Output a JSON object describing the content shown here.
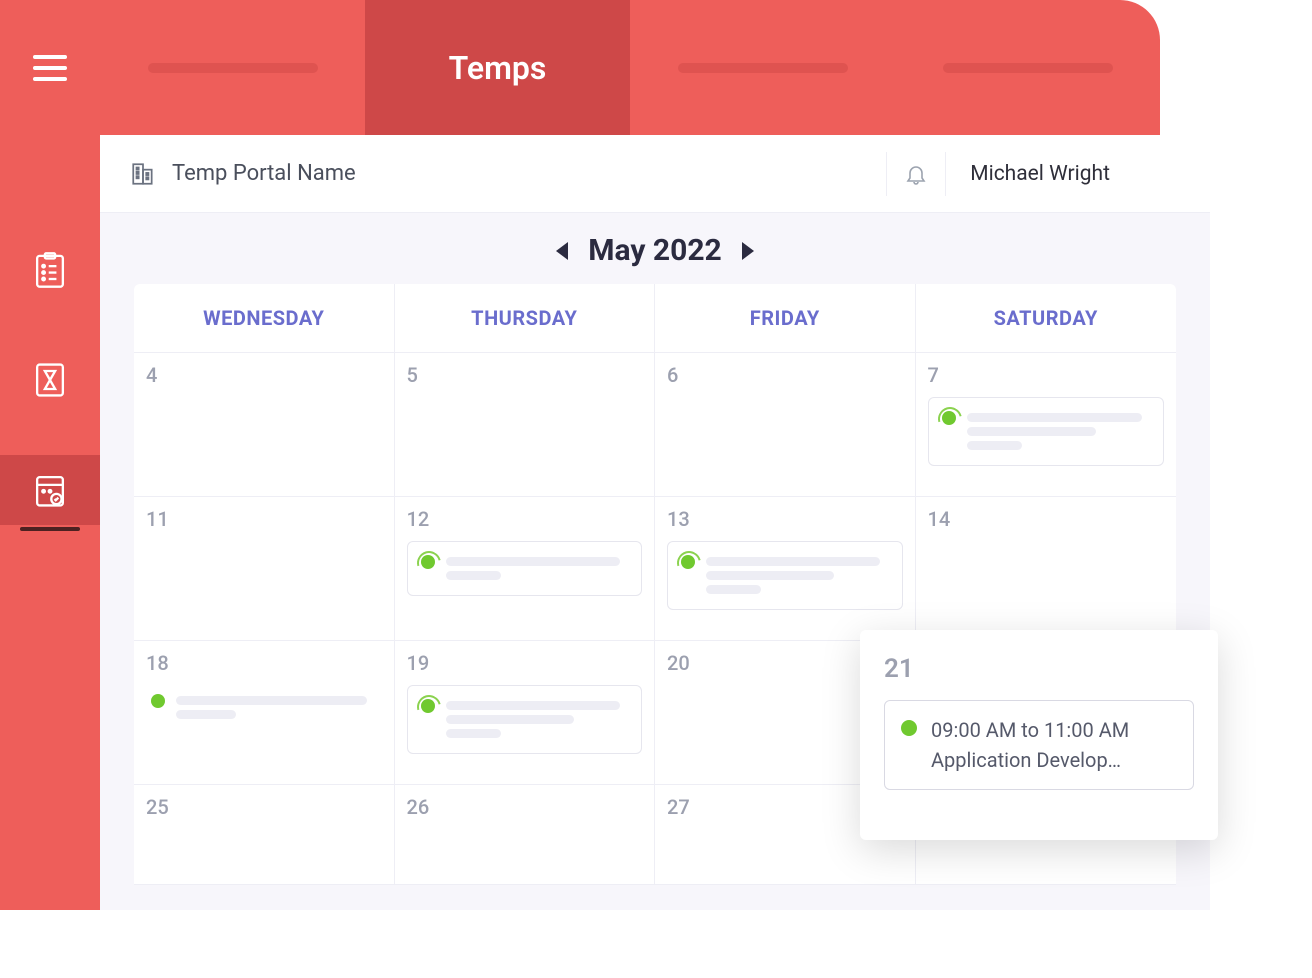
{
  "tabs": {
    "active_label": "Temps"
  },
  "header": {
    "portal_name": "Temp Portal Name",
    "user_name": "Michael Wright"
  },
  "month": {
    "label": "May 2022"
  },
  "weekdays": [
    "WEDNESDAY",
    "THURSDAY",
    "FRIDAY",
    "SATURDAY"
  ],
  "days": {
    "row1": [
      "4",
      "5",
      "6",
      "7"
    ],
    "row2": [
      "11",
      "12",
      "13",
      "14"
    ],
    "row3": [
      "18",
      "19",
      "20",
      "21"
    ],
    "row4": [
      "25",
      "26",
      "27",
      ""
    ]
  },
  "popup": {
    "day": "21",
    "time": "09:00 AM to 11:00 AM",
    "title": "Application Develop…"
  }
}
